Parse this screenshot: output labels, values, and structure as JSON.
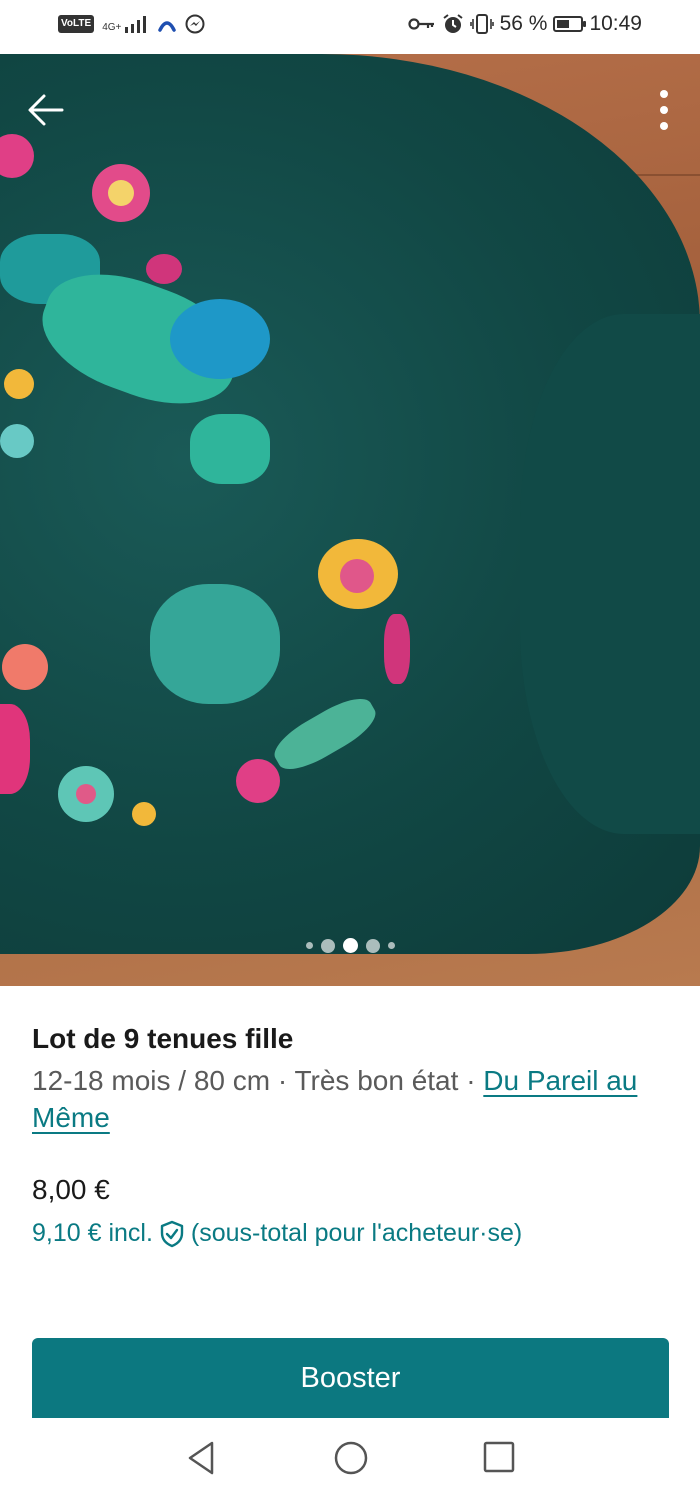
{
  "status_bar": {
    "left_icons": [
      "volte-icon",
      "4g-signal-icon",
      "cast-icon",
      "messenger-icon"
    ],
    "volte_label": "VoLTE",
    "network_label": "4G+",
    "battery_percent_label": "56 %",
    "battery_level": 0.56,
    "time": "10:49"
  },
  "photo": {
    "icons": [
      "back-arrow-icon",
      "more-vertical-icon"
    ],
    "carousel": {
      "count": 5,
      "active_index": 2
    }
  },
  "item": {
    "title": "Lot de 9 tenues fille",
    "meta_text": "12-18 mois / 80 cm · Très bon état · ",
    "brand": "Du Pareil au Même",
    "price": "8,00 €",
    "price_incl": "9,10 € incl.",
    "buyer_note": "(sous-total pour l'acheteur·se)"
  },
  "actions": {
    "booster_label": "Booster"
  },
  "colors": {
    "accent": "#0c7880",
    "link": "#0a7a83"
  }
}
